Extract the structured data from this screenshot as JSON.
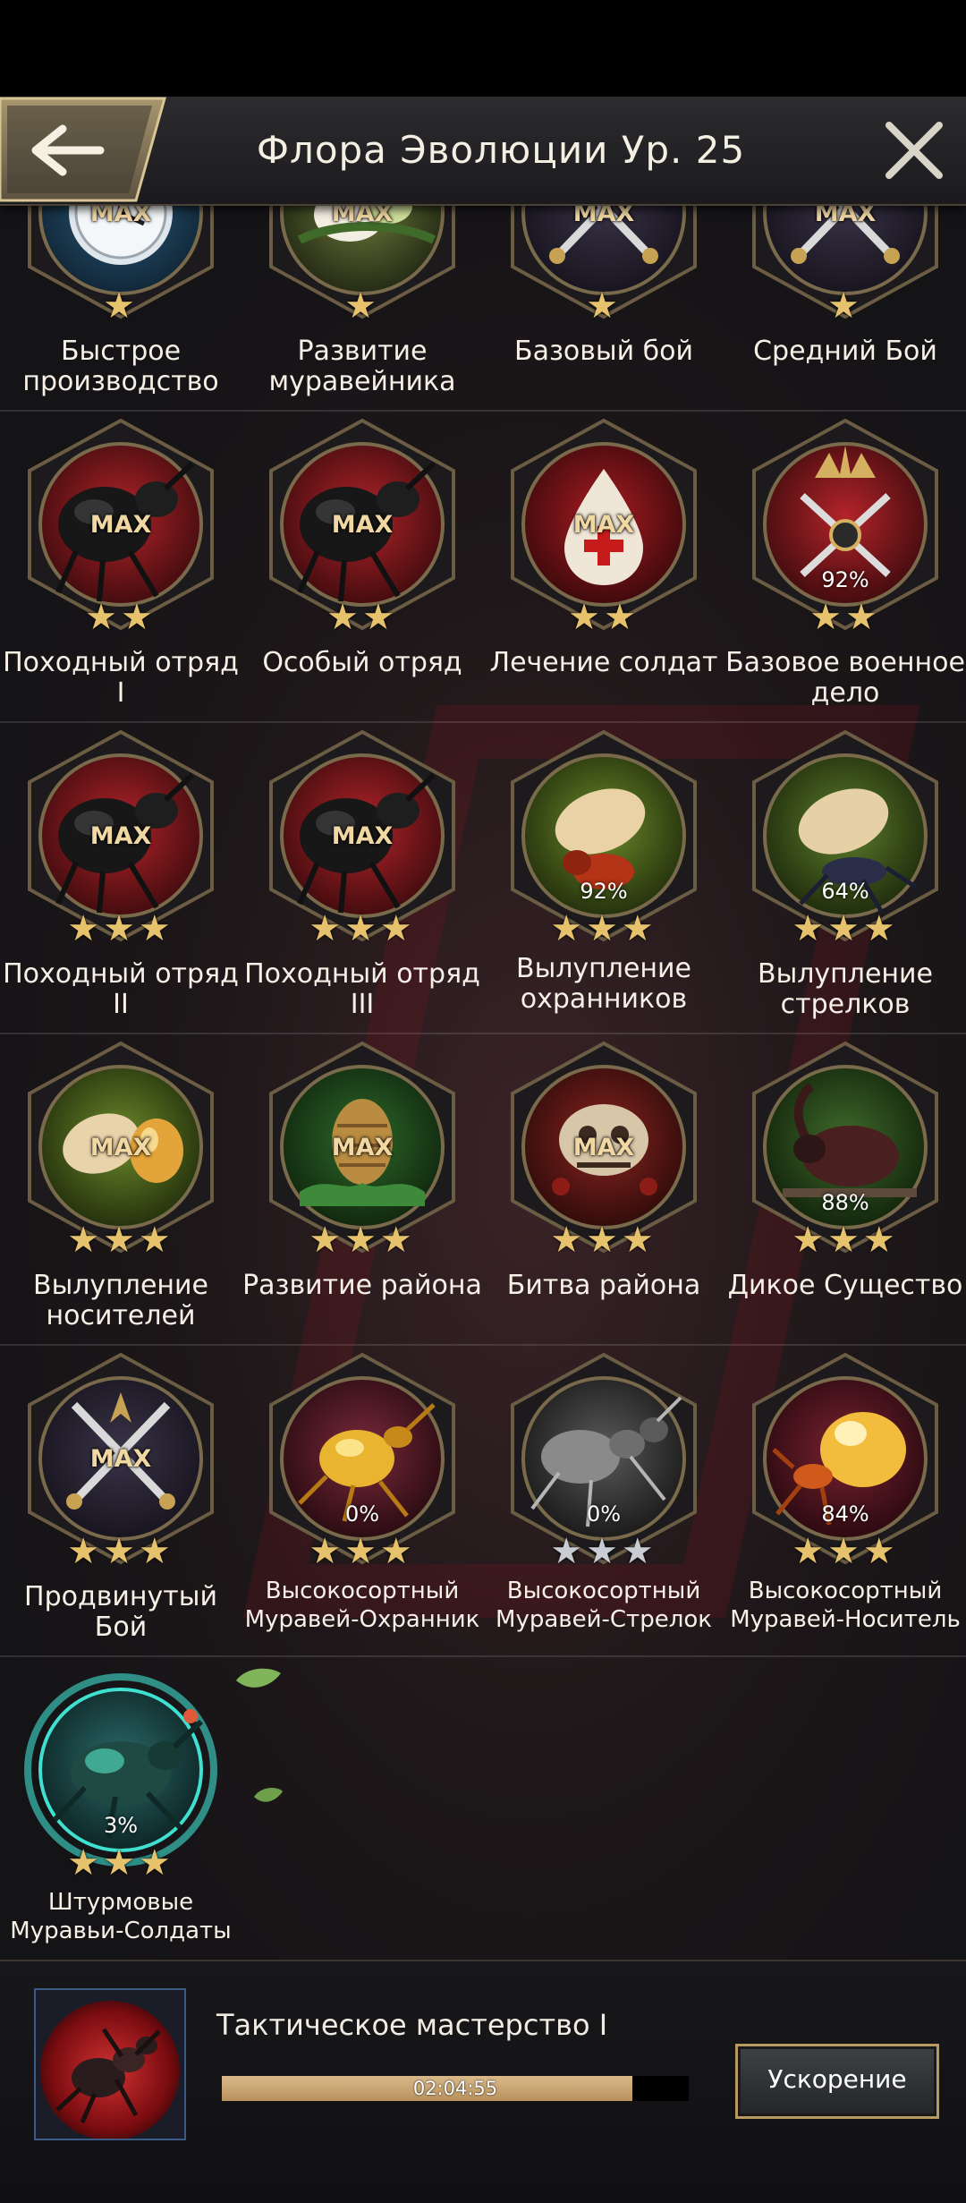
{
  "header": {
    "title": "Флора Эволюции Ур. 25"
  },
  "colors": {
    "gold": "#e7c26d",
    "silver": "#c9ccd3",
    "accent": "#b79a62"
  },
  "rows": [
    {
      "items": [
        {
          "label": "Быстрое производство",
          "status": "MAX",
          "stars": 1,
          "star_color": "gold",
          "icon": "clock-icon"
        },
        {
          "label": "Развитие муравейника",
          "status": "MAX",
          "stars": 1,
          "star_color": "gold",
          "icon": "egg-icon"
        },
        {
          "label": "Базовый бой",
          "status": "MAX",
          "stars": 1,
          "star_color": "gold",
          "icon": "crossed-swords-icon"
        },
        {
          "label": "Средний Бой",
          "status": "MAX",
          "stars": 1,
          "star_color": "gold",
          "icon": "crossed-swords-icon"
        }
      ]
    },
    {
      "items": [
        {
          "label": "Походный отряд I",
          "status": "MAX",
          "stars": 2,
          "star_color": "gold",
          "icon": "black-ant-icon"
        },
        {
          "label": "Особый отряд",
          "status": "MAX",
          "stars": 2,
          "star_color": "gold",
          "icon": "black-ant-icon"
        },
        {
          "label": "Лечение солдат",
          "status": "MAX",
          "stars": 2,
          "star_color": "gold",
          "icon": "blood-drop-icon"
        },
        {
          "label": "Базовое военное дело",
          "status": "92%",
          "stars": 2,
          "star_color": "gold",
          "icon": "sword-crest-icon"
        }
      ]
    },
    {
      "items": [
        {
          "label": "Походный отряд II",
          "status": "MAX",
          "stars": 3,
          "star_color": "gold",
          "icon": "black-ant-icon"
        },
        {
          "label": "Походный отряд III",
          "status": "MAX",
          "stars": 3,
          "star_color": "gold",
          "icon": "black-ant-icon"
        },
        {
          "label": "Вылупление охранников",
          "status": "92%",
          "stars": 3,
          "star_color": "gold",
          "icon": "red-ant-egg-icon"
        },
        {
          "label": "Вылупление стрелков",
          "status": "64%",
          "stars": 3,
          "star_color": "gold",
          "icon": "blue-ant-egg-icon"
        }
      ]
    },
    {
      "items": [
        {
          "label": "Вылупление носителей",
          "status": "MAX",
          "stars": 3,
          "star_color": "gold",
          "icon": "amber-egg-icon"
        },
        {
          "label": "Развитие района",
          "status": "MAX",
          "stars": 3,
          "star_color": "gold",
          "icon": "pinecone-icon"
        },
        {
          "label": "Битва района",
          "status": "MAX",
          "stars": 3,
          "star_color": "gold",
          "icon": "skull-icon"
        },
        {
          "label": "Дикое Существо",
          "status": "88%",
          "stars": 3,
          "star_color": "gold",
          "icon": "beetle-icon"
        }
      ]
    },
    {
      "items": [
        {
          "label": "Продвинутый Бой",
          "status": "MAX",
          "stars": 3,
          "star_color": "gold",
          "icon": "crossed-swords-icon"
        },
        {
          "label": "Высокосортный Муравей-Охранник",
          "status": "0%",
          "stars": 3,
          "star_color": "gold",
          "icon": "gold-beetle-icon"
        },
        {
          "label": "Высокосортный Муравей-Стрелок",
          "status": "0%",
          "stars": 3,
          "star_color": "silver",
          "icon": "grey-ant-icon"
        },
        {
          "label": "Высокосортный Муравей-Носитель",
          "status": "84%",
          "stars": 3,
          "star_color": "gold",
          "icon": "amber-ant-icon"
        }
      ]
    },
    {
      "items": [
        {
          "label": "Штурмовые Муравьи-Солдаты",
          "status": "3%",
          "stars": 3,
          "star_color": "gold",
          "icon": "assault-ant-icon",
          "glow": true
        }
      ]
    }
  ],
  "footer": {
    "task_title": "Тактическое мастерство I",
    "progress": 0.88,
    "timer": "02:04:55",
    "speed_up_label": "Ускорение"
  }
}
